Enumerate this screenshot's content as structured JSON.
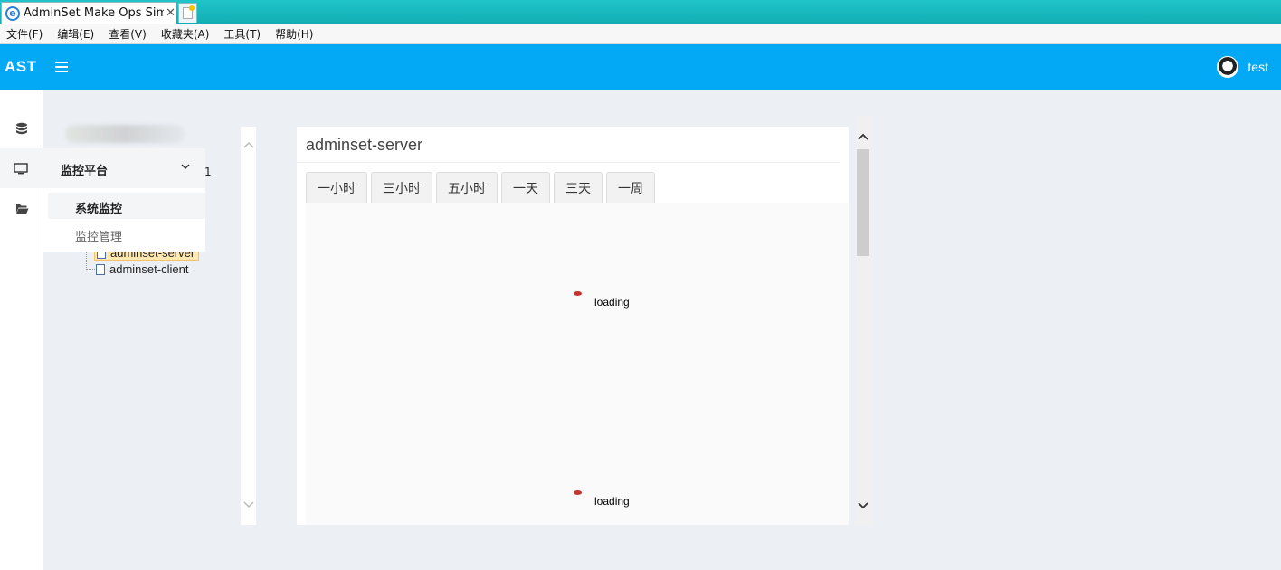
{
  "browser": {
    "tab_title": "AdminSet Make Ops Sim...",
    "tab_close": "✕",
    "menu": [
      "文件(F)",
      "编辑(E)",
      "查看(V)",
      "收藏夹(A)",
      "工具(T)",
      "帮助(H)"
    ]
  },
  "header": {
    "logo": "AST",
    "username": "test"
  },
  "sidebar": {
    "icons": [
      "database-icon",
      "monitor-icon",
      "folder-open-icon"
    ],
    "active_menu": "监控平台",
    "submenu": [
      "系统监控",
      "监控管理"
    ]
  },
  "tree": {
    "partial_text": "1",
    "nodes": [
      "adminset-server",
      "adminset-client"
    ],
    "selected": "adminset-server"
  },
  "main": {
    "title": "adminset-server",
    "time_buttons": [
      "一小时",
      "三小时",
      "五小时",
      "一天",
      "三天",
      "一周"
    ],
    "charts": [
      {
        "status": "loading"
      },
      {
        "status": "loading"
      }
    ]
  },
  "colors": {
    "header_bg": "#03a9f4",
    "loader_dot": "#c23531"
  }
}
